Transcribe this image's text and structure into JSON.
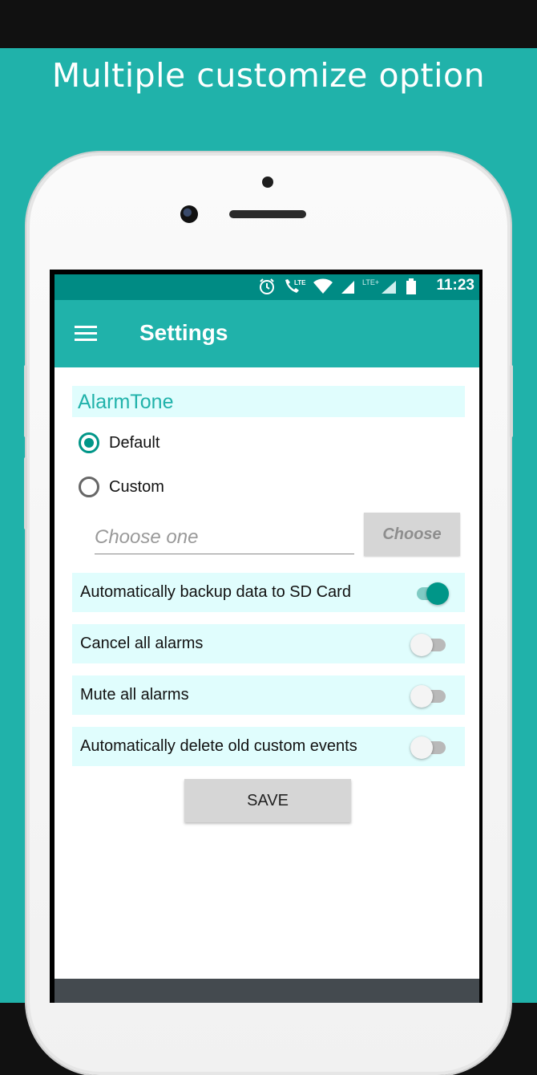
{
  "promo": {
    "title": "Multiple customize option",
    "background": "#20B2AA"
  },
  "status_bar": {
    "time": "11:23",
    "icons": [
      "alarm-clock-icon",
      "lte-call-icon",
      "wifi-icon",
      "signal-icon",
      "lte-plus-signal-icon",
      "battery-icon"
    ],
    "lte_label": "LTE",
    "lte_plus_label": "LTE+"
  },
  "app_bar": {
    "title": "Settings",
    "menu_icon": "hamburger-menu-icon",
    "color": "#20B2AA"
  },
  "alarm_tone": {
    "heading": "AlarmTone",
    "options": [
      {
        "label": "Default",
        "checked": true
      },
      {
        "label": "Custom",
        "checked": false
      }
    ],
    "input_placeholder": "Choose one",
    "choose_button": "Choose"
  },
  "settings": [
    {
      "label": "Automatically backup data to SD Card",
      "enabled": true
    },
    {
      "label": "Cancel all alarms",
      "enabled": false
    },
    {
      "label": "Mute all alarms",
      "enabled": false
    },
    {
      "label": "Automatically delete old custom events",
      "enabled": false
    }
  ],
  "save_button": "SAVE",
  "accent_color": "#009688"
}
